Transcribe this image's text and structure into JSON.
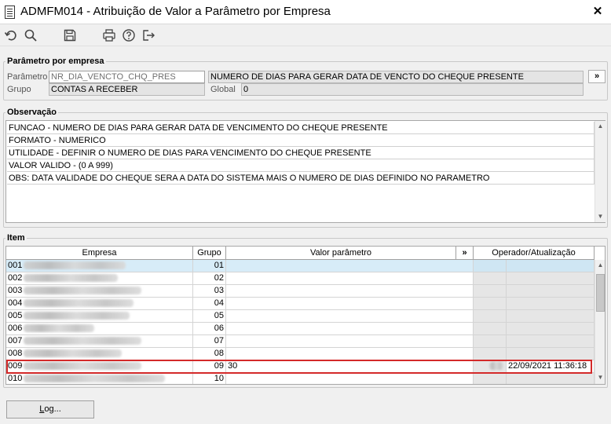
{
  "window": {
    "title": "ADMFM014 - Atribuição de Valor a Parâmetro por Empresa",
    "close_glyph": "✕"
  },
  "toolbar": {
    "buttons": [
      {
        "name": "undo-icon"
      },
      {
        "name": "search-icon"
      },
      {
        "name": "save-icon"
      },
      {
        "name": "print-icon"
      },
      {
        "name": "help-icon"
      },
      {
        "name": "exit-icon"
      }
    ]
  },
  "param_section": {
    "legend": "Parâmetro por empresa",
    "parametro_label": "Parâmetro",
    "parametro_value": "NR_DIA_VENCTO_CHQ_PRES",
    "descricao_value": "NUMERO DE DIAS PARA GERAR DATA DE VENCTO DO CHEQUE PRESENTE",
    "more_button": "»",
    "grupo_label": "Grupo",
    "grupo_value": "CONTAS A RECEBER",
    "global_label": "Global",
    "global_value": "0"
  },
  "observacao": {
    "legend": "Observação",
    "lines": [
      "FUNCAO - NUMERO DE DIAS PARA GERAR DATA DE VENCIMENTO DO CHEQUE PRESENTE",
      "FORMATO - NUMERICO",
      "UTILIDADE - DEFINIR O NUMERO DE DIAS PARA VENCIMENTO DO CHEQUE PRESENTE",
      "VALOR VALIDO - (0 A 999)",
      "OBS: DATA VALIDADE DO CHEQUE SERA A DATA DO SISTEMA MAIS O NUMERO DE DIAS DEFINIDO NO PARAMETRO"
    ]
  },
  "item": {
    "legend": "Item",
    "headers": {
      "empresa": "Empresa",
      "grupo": "Grupo",
      "valor": "Valor parâmetro",
      "more": "»",
      "operador": "Operador/Atualização"
    },
    "rows": [
      {
        "code": "001",
        "grupo": "01",
        "valor": "",
        "operador": "",
        "data": "",
        "selected": true
      },
      {
        "code": "002",
        "grupo": "02",
        "valor": "",
        "operador": "",
        "data": "",
        "selected": false
      },
      {
        "code": "003",
        "grupo": "03",
        "valor": "",
        "operador": "",
        "data": "",
        "selected": false
      },
      {
        "code": "004",
        "grupo": "04",
        "valor": "",
        "operador": "",
        "data": "",
        "selected": false
      },
      {
        "code": "005",
        "grupo": "05",
        "valor": "",
        "operador": "",
        "data": "",
        "selected": false
      },
      {
        "code": "006",
        "grupo": "06",
        "valor": "",
        "operador": "",
        "data": "",
        "selected": false
      },
      {
        "code": "007",
        "grupo": "07",
        "valor": "",
        "operador": "",
        "data": "",
        "selected": false
      },
      {
        "code": "008",
        "grupo": "08",
        "valor": "",
        "operador": "",
        "data": "",
        "selected": false
      },
      {
        "code": "009",
        "grupo": "09",
        "valor": "30",
        "operador": "",
        "data": "22/09/2021 11:36:18",
        "selected": false
      },
      {
        "code": "010",
        "grupo": "10",
        "valor": "",
        "operador": "",
        "data": "",
        "selected": false
      }
    ]
  },
  "footer": {
    "log_button": "Log..."
  },
  "colors": {
    "selection": "#d7ecf8",
    "highlight": "#d42a2a"
  }
}
